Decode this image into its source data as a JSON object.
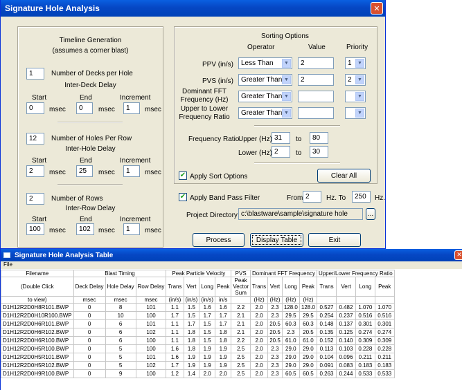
{
  "dialog": {
    "title": "Signature Hole Analysis",
    "timeline": {
      "heading1": "Timeline Generation",
      "heading2": "(assumes a corner blast)",
      "decks_value": "1",
      "decks_label": "Number of Decks per Hole",
      "deck_delay_title": "Inter-Deck Delay",
      "start_label": "Start",
      "end_label": "End",
      "increment_label": "Increment",
      "msec": "msec",
      "deck_start": "0",
      "deck_end": "0",
      "deck_inc": "1",
      "holes_value": "12",
      "holes_label": "Number of Holes Per Row",
      "hole_delay_title": "Inter-Hole Delay",
      "hole_start": "2",
      "hole_end": "25",
      "hole_inc": "1",
      "rows_value": "2",
      "rows_label": "Number of Rows",
      "row_delay_title": "Inter-Row Delay",
      "row_start": "100",
      "row_end": "102",
      "row_inc": "1"
    },
    "sorting": {
      "heading": "Sorting Options",
      "col_operator": "Operator",
      "col_value": "Value",
      "col_priority": "Priority",
      "rows": [
        {
          "label": "PPV (in/s)",
          "operator": "Less Than",
          "value": "2",
          "priority": "1"
        },
        {
          "label": "PVS (in/s)",
          "operator": "Greater Than",
          "value": "2",
          "priority": "2"
        },
        {
          "label": "Dominant FFT\nFrequency (Hz)",
          "operator": "Greater Than",
          "value": "",
          "priority": ""
        },
        {
          "label": "Upper to Lower\nFrequency Ratio",
          "operator": "Greater Than",
          "value": "",
          "priority": ""
        }
      ],
      "freq_ratio_label": "Frequency Ratio",
      "upper_label": "Upper (Hz)",
      "lower_label": "Lower (Hz)",
      "to": "to",
      "upper_from": "31",
      "upper_to": "80",
      "lower_from": "2",
      "lower_to": "30",
      "apply_sort_label": "Apply Sort Options",
      "clear_all": "Clear All"
    },
    "band_pass": {
      "label": "Apply Band Pass Filter",
      "from_label": "From",
      "from": "2",
      "hz_to": "Hz.  To",
      "to": "250",
      "hz": "Hz."
    },
    "project": {
      "label": "Project Directory",
      "path": "c:\\blastware\\sample\\signature hole",
      "browse": "..."
    },
    "buttons": {
      "process": "Process",
      "display_table": "Display Table",
      "exit": "Exit"
    }
  },
  "table_window": {
    "title": "Signature Hole Analysis Table",
    "menu_file": "File",
    "groups": [
      "Filename",
      "Blast Timing",
      "Peak Particle Velocity",
      "PVS",
      "Dominant FFT Frequency",
      "Upper/Lower Frequency Ratio"
    ],
    "filename_sub": [
      "(Double Click",
      "to view)"
    ],
    "timing_cols": [
      "Deck Delay",
      "Hole Delay",
      "Row Delay"
    ],
    "timing_units": [
      "msec",
      "msec",
      "msec"
    ],
    "ppv_cols": [
      "Trans",
      "Vert",
      "Long",
      "Peak"
    ],
    "ppv_units": [
      "(in/s)",
      "(in/s)",
      "(in/s)",
      "in/s"
    ],
    "pvs_cols": [
      "Peak Vector Sum"
    ],
    "fft_cols": [
      "Trans",
      "Vert",
      "Long",
      "Peak"
    ],
    "fft_units": [
      "(Hz)",
      "(Hz)",
      "(Hz)",
      "(Hz)"
    ],
    "ratio_cols": [
      "Trans",
      "Vert",
      "Long",
      "Peak"
    ],
    "rows": [
      [
        "D1H12R2D0H8R101.BWP",
        "0",
        "8",
        "101",
        "1.1",
        "1.5",
        "1.6",
        "1.6",
        "2.2",
        "2.0",
        "2.3",
        "128.0",
        "128.0",
        "0.527",
        "0.482",
        "1.070",
        "1.070"
      ],
      [
        "D1H12R2D0H10R100.BWP",
        "0",
        "10",
        "100",
        "1.7",
        "1.5",
        "1.7",
        "1.7",
        "2.1",
        "2.0",
        "2.3",
        "29.5",
        "29.5",
        "0.254",
        "0.237",
        "0.516",
        "0.516"
      ],
      [
        "D1H12R2D0H6R101.BWP",
        "0",
        "6",
        "101",
        "1.1",
        "1.7",
        "1.5",
        "1.7",
        "2.1",
        "2.0",
        "20.5",
        "60.3",
        "60.3",
        "0.148",
        "0.137",
        "0.301",
        "0.301"
      ],
      [
        "D1H12R2D0H6R102.BWP",
        "0",
        "6",
        "102",
        "1.1",
        "1.8",
        "1.5",
        "1.8",
        "2.1",
        "2.0",
        "20.5",
        "2.3",
        "20.5",
        "0.135",
        "0.125",
        "0.274",
        "0.274"
      ],
      [
        "D1H12R2D0H6R100.BWP",
        "0",
        "6",
        "100",
        "1.1",
        "1.8",
        "1.5",
        "1.8",
        "2.2",
        "2.0",
        "20.5",
        "61.0",
        "61.0",
        "0.152",
        "0.140",
        "0.309",
        "0.309"
      ],
      [
        "D1H12R2D0H5R100.BWP",
        "0",
        "5",
        "100",
        "1.6",
        "1.8",
        "1.9",
        "1.9",
        "2.5",
        "2.0",
        "2.3",
        "29.0",
        "29.0",
        "0.113",
        "0.103",
        "0.228",
        "0.228"
      ],
      [
        "D1H12R2D0H5R101.BWP",
        "0",
        "5",
        "101",
        "1.6",
        "1.9",
        "1.9",
        "1.9",
        "2.5",
        "2.0",
        "2.3",
        "29.0",
        "29.0",
        "0.104",
        "0.096",
        "0.211",
        "0.211"
      ],
      [
        "D1H12R2D0H5R102.BWP",
        "0",
        "5",
        "102",
        "1.7",
        "1.9",
        "1.9",
        "1.9",
        "2.5",
        "2.0",
        "2.3",
        "29.0",
        "29.0",
        "0.091",
        "0.083",
        "0.183",
        "0.183"
      ],
      [
        "D1H12R2D0H9R100.BWP",
        "0",
        "9",
        "100",
        "1.2",
        "1.4",
        "2.0",
        "2.0",
        "2.5",
        "2.0",
        "2.3",
        "60.5",
        "60.5",
        "0.263",
        "0.244",
        "0.533",
        "0.533"
      ]
    ]
  }
}
